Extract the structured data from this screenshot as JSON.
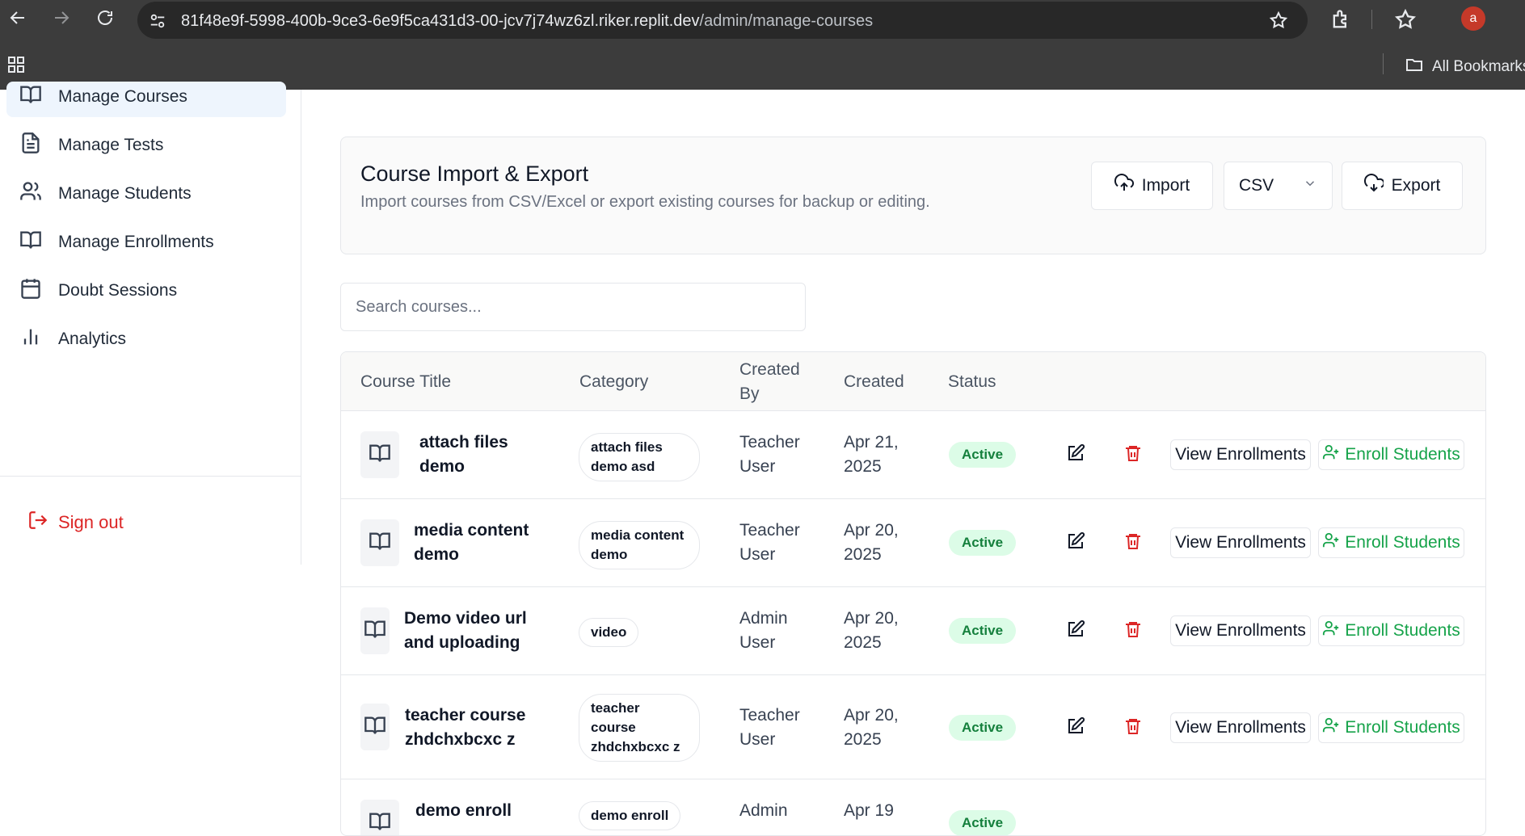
{
  "browser": {
    "url_host": "81f48e9f-5998-400b-9ce3-6e9f5ca431d3-00-jcv7j74wz6zl.riker.replit.dev",
    "url_path": "/admin/manage-courses",
    "profile_initial": "a",
    "bookmarks_label": "All Bookmarks"
  },
  "sidebar": {
    "items": [
      {
        "label": "Manage Courses",
        "icon": "book-open-icon",
        "active": true
      },
      {
        "label": "Manage Tests",
        "icon": "file-text-icon"
      },
      {
        "label": "Manage Students",
        "icon": "users-icon"
      },
      {
        "label": "Manage Enrollments",
        "icon": "book-open-icon"
      },
      {
        "label": "Doubt Sessions",
        "icon": "calendar-icon"
      },
      {
        "label": "Analytics",
        "icon": "bar-chart-icon"
      }
    ],
    "sign_out": "Sign out"
  },
  "import_export": {
    "title": "Course Import & Export",
    "subtitle": "Import courses from CSV/Excel or export existing courses for backup or editing.",
    "import_label": "Import",
    "format_value": "CSV",
    "export_label": "Export"
  },
  "search": {
    "placeholder": "Search courses..."
  },
  "table": {
    "headers": {
      "title": "Course Title",
      "category": "Category",
      "created_by": "Created By",
      "created": "Created",
      "status": "Status"
    },
    "view_label": "View Enrollments",
    "enroll_label": "Enroll Students",
    "rows": [
      {
        "title": "attach files demo",
        "category": "attach files demo asd",
        "created_by": "Teacher User",
        "created": "Apr 21, 2025",
        "status": "Active"
      },
      {
        "title": "media content demo",
        "category": "media content demo",
        "created_by": "Teacher User",
        "created": "Apr 20, 2025",
        "status": "Active"
      },
      {
        "title": "Demo video url and uploading",
        "category": "video",
        "created_by": "Admin User",
        "created": "Apr 20, 2025",
        "status": "Active"
      },
      {
        "title": "teacher course zhdchxbcxc z",
        "category": "teacher course zhdchxbcxc z",
        "created_by": "Teacher User",
        "created": "Apr 20, 2025",
        "status": "Active"
      },
      {
        "title": "demo enroll",
        "category": "demo enroll",
        "created_by": "Admin",
        "created": "Apr 19",
        "status": "Active"
      }
    ]
  },
  "colors": {
    "active_badge_bg": "#dcfce7",
    "active_badge_text": "#15803d",
    "danger": "#dc2626",
    "enroll_green": "#16a34a"
  }
}
